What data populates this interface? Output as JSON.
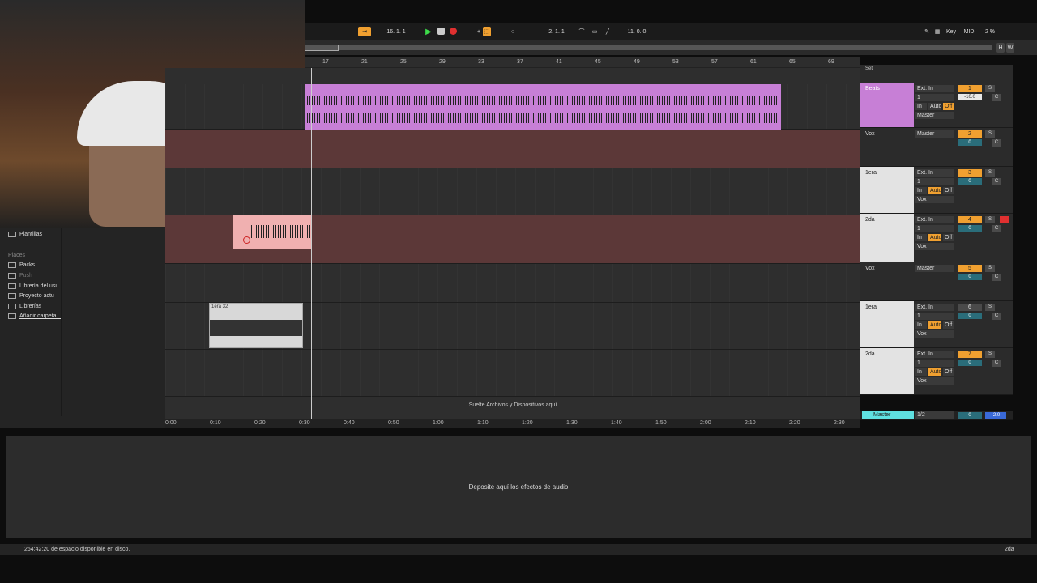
{
  "transport": {
    "bar_position": "16. 1. 1",
    "loop_start": "2. 1. 1",
    "loop_length": "11. 0. 0",
    "key_label": "Key",
    "midi_label": "MIDI",
    "cpu": "2 %"
  },
  "ruler": {
    "ticks": [
      "17",
      "21",
      "25",
      "29",
      "33",
      "37",
      "41",
      "45",
      "49",
      "53",
      "57",
      "61",
      "65",
      "69"
    ]
  },
  "timeline": {
    "ticks": [
      "0:00",
      "0:10",
      "0:20",
      "0:30",
      "0:40",
      "0:50",
      "1:00",
      "1:10",
      "1:20",
      "1:30",
      "1:40",
      "1:50",
      "2:00",
      "2:10",
      "2:20",
      "2:30"
    ]
  },
  "set_label": "Set",
  "tracks": [
    {
      "name": "Beats",
      "input": "Ext. In",
      "channel": "1",
      "in": "In",
      "auto": "Auto",
      "off": "Off",
      "output": "Master",
      "number": "1",
      "s": "S",
      "volume": "-10.0",
      "pan": "C"
    },
    {
      "name": "Vox",
      "output": "Master",
      "number": "2",
      "s": "S",
      "volume": "0",
      "pan": "C"
    },
    {
      "name": "1era",
      "input": "Ext. In",
      "channel": "1",
      "in": "In",
      "auto": "Auto",
      "off": "Off",
      "output": "Vox",
      "number": "3",
      "s": "S",
      "volume": "0",
      "pan": "C"
    },
    {
      "name": "2da",
      "input": "Ext. In",
      "channel": "1",
      "in": "In",
      "auto": "Auto",
      "off": "Off",
      "output": "Vox",
      "number": "4",
      "s": "S",
      "volume": "0",
      "pan": "C"
    },
    {
      "name": "Vox",
      "output": "Master",
      "number": "5",
      "s": "S",
      "volume": "0",
      "pan": "C"
    },
    {
      "name": "1era",
      "input": "Ext. In",
      "channel": "1",
      "in": "In",
      "auto": "Auto",
      "off": "Off",
      "output": "Vox",
      "number": "6",
      "s": "S",
      "volume": "0",
      "pan": "C"
    },
    {
      "name": "2da",
      "input": "Ext. In",
      "channel": "1",
      "in": "In",
      "auto": "Auto",
      "off": "Off",
      "output": "Vox",
      "number": "7",
      "s": "S",
      "volume": "0",
      "pan": "C"
    }
  ],
  "master": {
    "name": "Master",
    "routing": "1/2",
    "volume": "0",
    "pan": "-2.0"
  },
  "clip": {
    "name": "1era 32"
  },
  "drop_text": "Suelte Archivos y Dispositivos aquí",
  "browser": {
    "templates": "Plantillas",
    "places": "Places",
    "packs": "Packs",
    "push": "Push",
    "user_library": "Librería del usu",
    "project": "Proyecto actu",
    "libraries": "Librerías",
    "add_folder": "Añadir carpeta..."
  },
  "devices_text": "Deposite aquí los efectos de audio",
  "status": {
    "disk": "264:42:20 de espacio disponible en disco.",
    "track": "2da"
  },
  "colors": {
    "beats": "#c77fd6",
    "vox": "#5c3838",
    "accent": "#f0a030"
  }
}
